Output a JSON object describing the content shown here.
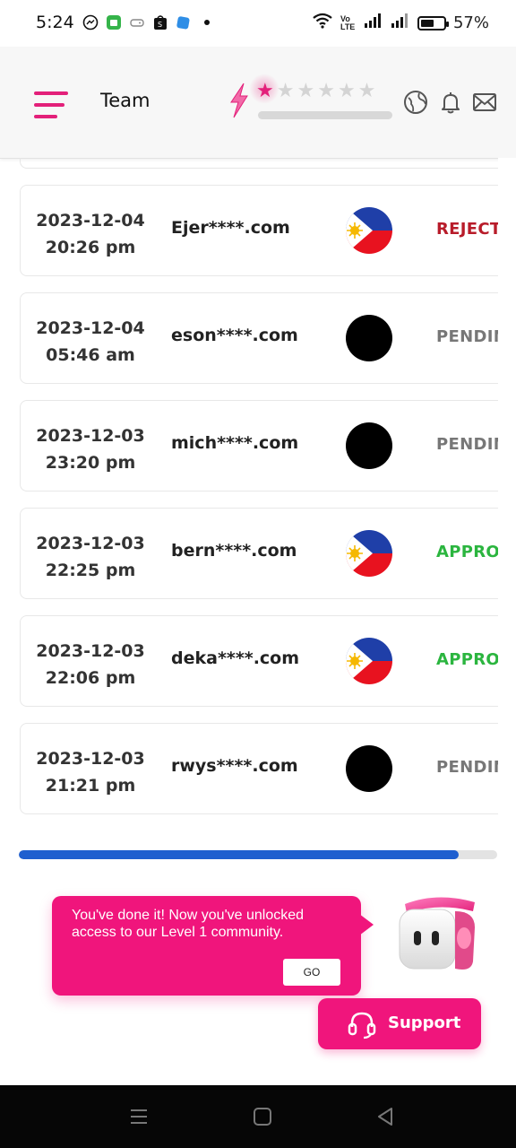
{
  "status_bar": {
    "time": "5:24",
    "network_label": "Vo LTE",
    "battery_percent": "57%",
    "battery_level": 0.57,
    "left_icons": [
      "messenger-icon",
      "shop-app-icon",
      "game-icon",
      "shopee-icon",
      "app-icon",
      "dot-icon"
    ]
  },
  "header": {
    "title": "Team",
    "rating": {
      "filled": 1,
      "total": 6
    },
    "accent_color": "#e3207a",
    "icons": [
      "language-globe-icon",
      "bell-icon",
      "mail-icon"
    ]
  },
  "records": [
    {
      "date": "2023-12-04",
      "time": "20:26 pm",
      "email": "Ejer****.com",
      "flag": "philippines",
      "status": "REJECT",
      "status_color": "#b81c2a"
    },
    {
      "date": "2023-12-04",
      "time": "05:46 am",
      "email": "eson****.com",
      "flag": "black",
      "status": "PENDIN",
      "status_color": "#777777"
    },
    {
      "date": "2023-12-03",
      "time": "23:20 pm",
      "email": "mich****.com",
      "flag": "black",
      "status": "PENDIN",
      "status_color": "#777777"
    },
    {
      "date": "2023-12-03",
      "time": "22:25 pm",
      "email": "bern****.com",
      "flag": "philippines",
      "status": "APPROV",
      "status_color": "#2bb53f"
    },
    {
      "date": "2023-12-03",
      "time": "22:06 pm",
      "email": "deka****.com",
      "flag": "philippines",
      "status": "APPROV",
      "status_color": "#2bb53f"
    },
    {
      "date": "2023-12-03",
      "time": "21:21 pm",
      "email": "rwys****.com",
      "flag": "black",
      "status": "PENDIN",
      "status_color": "#777777"
    }
  ],
  "scroll_progress": 0.92,
  "toast": {
    "message": "You've done it! Now you've unlocked access to our Level 1 community.",
    "button_label": "GO"
  },
  "support": {
    "label": "Support"
  }
}
